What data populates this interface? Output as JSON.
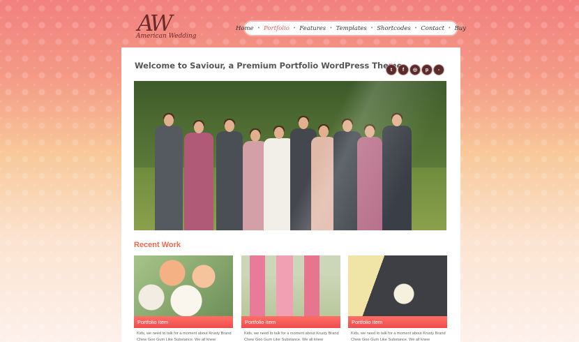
{
  "brand": {
    "monogram": "AW",
    "name": "American Wedding"
  },
  "nav": {
    "items": [
      {
        "label": "Home",
        "active": false
      },
      {
        "label": "Portfolio",
        "active": true
      },
      {
        "label": "Features",
        "active": false
      },
      {
        "label": "Templates",
        "active": false
      },
      {
        "label": "Shortcodes",
        "active": false
      },
      {
        "label": "Contact",
        "active": false
      },
      {
        "label": "Buy",
        "active": false
      }
    ],
    "separator": "•"
  },
  "header": {
    "welcome": "Welcome to Saviour, a Premium Portfolio WordPress Theme"
  },
  "social": [
    {
      "icon": "twitter-icon",
      "glyph": "t"
    },
    {
      "icon": "facebook-icon",
      "glyph": "f"
    },
    {
      "icon": "dribbble-icon",
      "glyph": "◎"
    },
    {
      "icon": "pinterest-icon",
      "glyph": "p"
    },
    {
      "icon": "flickr-icon",
      "glyph": "▫"
    }
  ],
  "slider": {
    "prev_glyph": "‹",
    "next_glyph": "›"
  },
  "recent": {
    "heading": "Recent Work",
    "items": [
      {
        "label": "Portfolio Item",
        "desc": "Kids, we need to talk for a moment about Krusty Brand Chew Goo Gum Like Substance. We all knew"
      },
      {
        "label": "Portfolio Item",
        "desc": "Kids, we need to talk for a moment about Krusty Brand Chew Goo Gum Like Substance. We all knew"
      },
      {
        "label": "Portfolio Item",
        "desc": "Kids, we need to talk for a moment about Krusty Brand Chew Goo Gum Like Substance. We all knew"
      }
    ]
  },
  "colors": {
    "accent": "#ea5a5a",
    "label_bar": "#ef4d4b",
    "logo": "#6b2b2b"
  }
}
